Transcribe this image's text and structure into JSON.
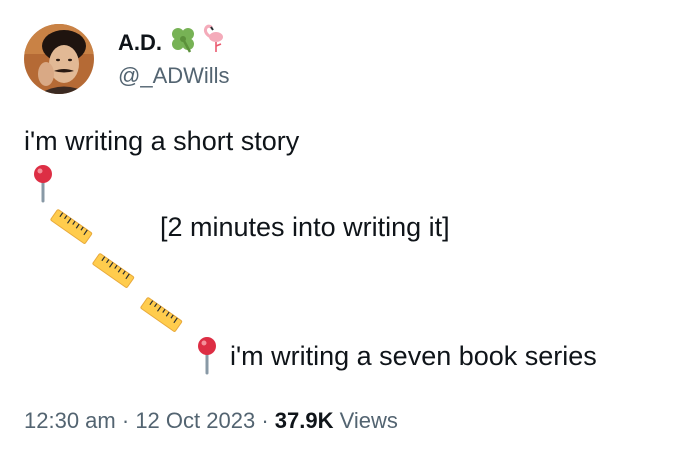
{
  "author": {
    "display_name": "A.D.",
    "name_emojis": [
      "four-leaf-clover-icon",
      "flamingo-icon"
    ],
    "handle": "@_ADWills"
  },
  "tweet": {
    "line1": "i'm writing a short story",
    "bracket_text": "[2 minutes into writing it]",
    "line_end": "i'm writing a seven book series",
    "emoji_sequence": [
      "round-pushpin-icon",
      "straight-ruler-icon",
      "straight-ruler-icon",
      "straight-ruler-icon",
      "round-pushpin-icon"
    ]
  },
  "meta": {
    "time": "12:30 am",
    "separator": "·",
    "date": "12 Oct 2023",
    "views_count": "37.9K",
    "views_label": "Views"
  },
  "colors": {
    "text": "#0f1419",
    "secondary_text": "#536471",
    "pin_red": "#dd2e44",
    "ruler_yellow": "#ffcc4d",
    "clover_green": "#77b255",
    "flamingo_pink": "#f4abba"
  }
}
